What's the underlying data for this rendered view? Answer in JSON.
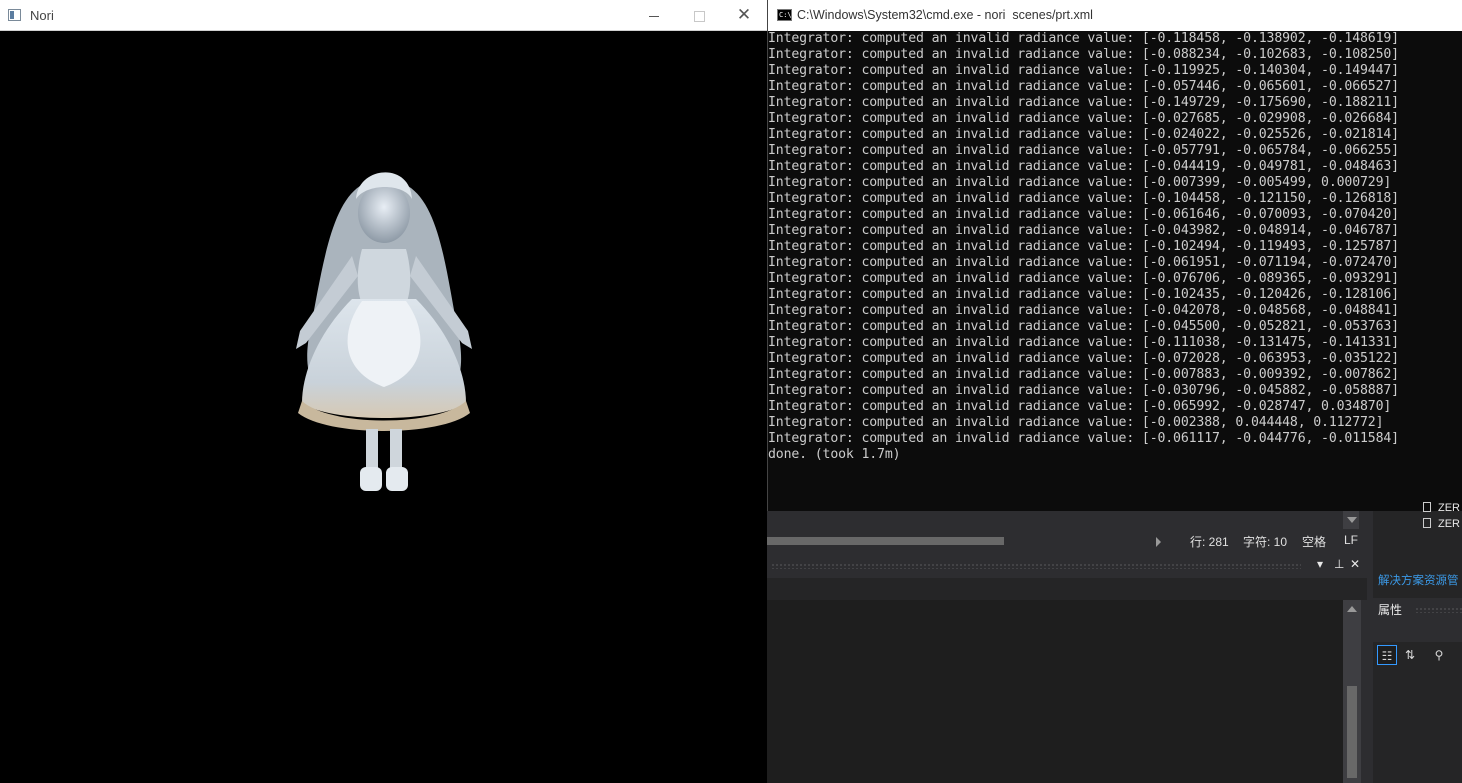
{
  "nori_window": {
    "title": "Nori",
    "minimize": "—",
    "maximize": "☐",
    "close": "✕"
  },
  "cmd_window": {
    "title": "C:\\Windows\\System32\\cmd.exe - nori  scenes/prt.xml",
    "icon_text": "C:\\"
  },
  "console": {
    "lines": [
      "Integrator: computed an invalid radiance value: [-0.118458, -0.138902, -0.148619]",
      "Integrator: computed an invalid radiance value: [-0.088234, -0.102683, -0.108250]",
      "Integrator: computed an invalid radiance value: [-0.119925, -0.140304, -0.149447]",
      "Integrator: computed an invalid radiance value: [-0.057446, -0.065601, -0.066527]",
      "Integrator: computed an invalid radiance value: [-0.149729, -0.175690, -0.188211]",
      "Integrator: computed an invalid radiance value: [-0.027685, -0.029908, -0.026684]",
      "Integrator: computed an invalid radiance value: [-0.024022, -0.025526, -0.021814]",
      "Integrator: computed an invalid radiance value: [-0.057791, -0.065784, -0.066255]",
      "Integrator: computed an invalid radiance value: [-0.044419, -0.049781, -0.048463]",
      "Integrator: computed an invalid radiance value: [-0.007399, -0.005499, 0.000729]",
      "Integrator: computed an invalid radiance value: [-0.104458, -0.121150, -0.126818]",
      "Integrator: computed an invalid radiance value: [-0.061646, -0.070093, -0.070420]",
      "Integrator: computed an invalid radiance value: [-0.043982, -0.048914, -0.046787]",
      "Integrator: computed an invalid radiance value: [-0.102494, -0.119493, -0.125787]",
      "Integrator: computed an invalid radiance value: [-0.061951, -0.071194, -0.072470]",
      "Integrator: computed an invalid radiance value: [-0.076706, -0.089365, -0.093291]",
      "Integrator: computed an invalid radiance value: [-0.102435, -0.120426, -0.128106]",
      "Integrator: computed an invalid radiance value: [-0.042078, -0.048568, -0.048841]",
      "Integrator: computed an invalid radiance value: [-0.045500, -0.052821, -0.053763]",
      "Integrator: computed an invalid radiance value: [-0.111038, -0.131475, -0.141331]",
      "Integrator: computed an invalid radiance value: [-0.072028, -0.063953, -0.035122]",
      "Integrator: computed an invalid radiance value: [-0.007883, -0.009392, -0.007862]",
      "Integrator: computed an invalid radiance value: [-0.030796, -0.045882, -0.058887]",
      "Integrator: computed an invalid radiance value: [-0.065992, -0.028747, 0.034870]",
      "Integrator: computed an invalid radiance value: [-0.002388, 0.044448, 0.112772]",
      "Integrator: computed an invalid radiance value: [-0.061117, -0.044776, -0.011584]",
      "done. (took 1.7m)"
    ]
  },
  "ide": {
    "status_line": "行: 281",
    "status_char": "字符: 10",
    "status_space": "空格",
    "status_eol": "LF",
    "panel_pin": "ꟷ",
    "panel_close": "✕",
    "solution_item_1": "ZER",
    "solution_item_0": "ZER",
    "solution_explorer_tab": "解决方案资源管",
    "properties_title": "属性"
  },
  "colors": {
    "console_bg": "#0c0c0c",
    "console_fg": "#cccccc",
    "ide_bg": "#2d2d30",
    "link_blue": "#3b9ae8"
  }
}
